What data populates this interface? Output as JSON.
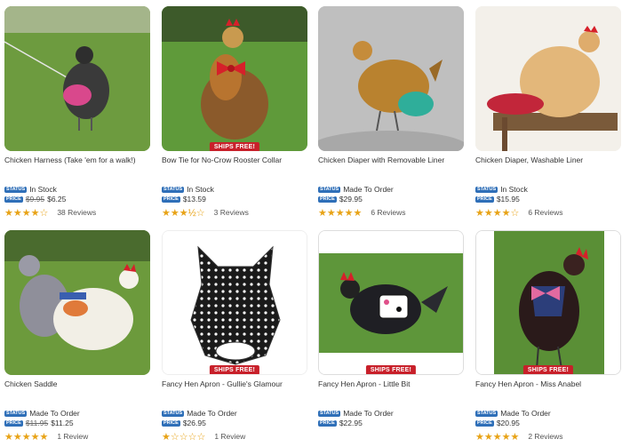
{
  "products": [
    {
      "title": "Chicken Harness (Take 'em for a walk!)",
      "status_badge": "STATUS",
      "status": "In Stock",
      "price_badge": "PRICE",
      "old_price": "$9.95",
      "price": "$6.25",
      "stars": "★★★★☆",
      "reviews": "38 Reviews",
      "ships_free": ""
    },
    {
      "title": "Bow Tie for No-Crow Rooster Collar",
      "status_badge": "STATUS",
      "status": "In Stock",
      "price_badge": "PRICE",
      "old_price": "",
      "price": "$13.59",
      "stars": "★★★½☆",
      "reviews": "3 Reviews",
      "ships_free": "SHIPS FREE!"
    },
    {
      "title": "Chicken Diaper with Removable Liner",
      "status_badge": "STATUS",
      "status": "Made To Order",
      "price_badge": "PRICE",
      "old_price": "",
      "price": "$29.95",
      "stars": "★★★★★",
      "reviews": "6 Reviews",
      "ships_free": ""
    },
    {
      "title": "Chicken Diaper, Washable Liner",
      "status_badge": "STATUS",
      "status": "In Stock",
      "price_badge": "PRICE",
      "old_price": "",
      "price": "$15.95",
      "stars": "★★★★☆",
      "reviews": "6 Reviews",
      "ships_free": ""
    },
    {
      "title": "Chicken Saddle",
      "status_badge": "STATUS",
      "status": "Made To Order",
      "price_badge": "PRICE",
      "old_price": "$11.95",
      "price": "$11.25",
      "stars": "★★★★★",
      "reviews": "1 Review",
      "ships_free": ""
    },
    {
      "title": "Fancy Hen Apron - Gullie's Glamour",
      "status_badge": "STATUS",
      "status": "Made To Order",
      "price_badge": "PRICE",
      "old_price": "",
      "price": "$26.95",
      "stars": "★☆☆☆☆",
      "reviews": "1 Review",
      "ships_free": "SHIPS FREE!"
    },
    {
      "title": "Fancy Hen Apron - Little Bit",
      "status_badge": "STATUS",
      "status": "Made To Order",
      "price_badge": "PRICE",
      "old_price": "",
      "price": "$22.95",
      "stars": "",
      "reviews": "",
      "ships_free": "SHIPS FREE!"
    },
    {
      "title": "Fancy Hen Apron - Miss Anabel",
      "status_badge": "STATUS",
      "status": "Made To Order",
      "price_badge": "PRICE",
      "old_price": "",
      "price": "$20.95",
      "stars": "★★★★★",
      "reviews": "2 Reviews",
      "ships_free": "SHIPS FREE!"
    }
  ],
  "colors": {
    "status_badge": "#2f6fb8",
    "ships_free": "#c8202a",
    "star": "#e8a317",
    "grass": "#6fa13a"
  }
}
